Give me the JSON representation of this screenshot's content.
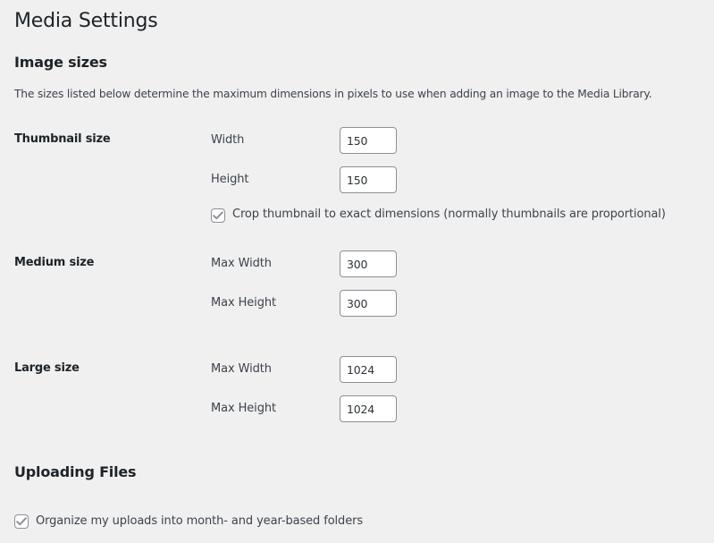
{
  "page": {
    "title": "Media Settings"
  },
  "image_sizes": {
    "heading": "Image sizes",
    "description": "The sizes listed below determine the maximum dimensions in pixels to use when adding an image to the Media Library.",
    "thumbnail": {
      "label": "Thumbnail size",
      "width_label": "Width",
      "width_value": "150",
      "height_label": "Height",
      "height_value": "150",
      "crop_label": "Crop thumbnail to exact dimensions (normally thumbnails are proportional)",
      "crop_checked": true,
      "crop_icon": "checkmark-icon"
    },
    "medium": {
      "label": "Medium size",
      "width_label": "Max Width",
      "width_value": "300",
      "height_label": "Max Height",
      "height_value": "300"
    },
    "large": {
      "label": "Large size",
      "width_label": "Max Width",
      "width_value": "1024",
      "height_label": "Max Height",
      "height_value": "1024"
    }
  },
  "uploading_files": {
    "heading": "Uploading Files",
    "organize_label": "Organize my uploads into month- and year-based folders",
    "organize_checked": true,
    "organize_icon": "checkmark-icon"
  },
  "colors": {
    "background": "#f0f0f1",
    "text": "#1d2327",
    "input_border": "#8c8f94",
    "checkmark": "#8c8f94"
  }
}
